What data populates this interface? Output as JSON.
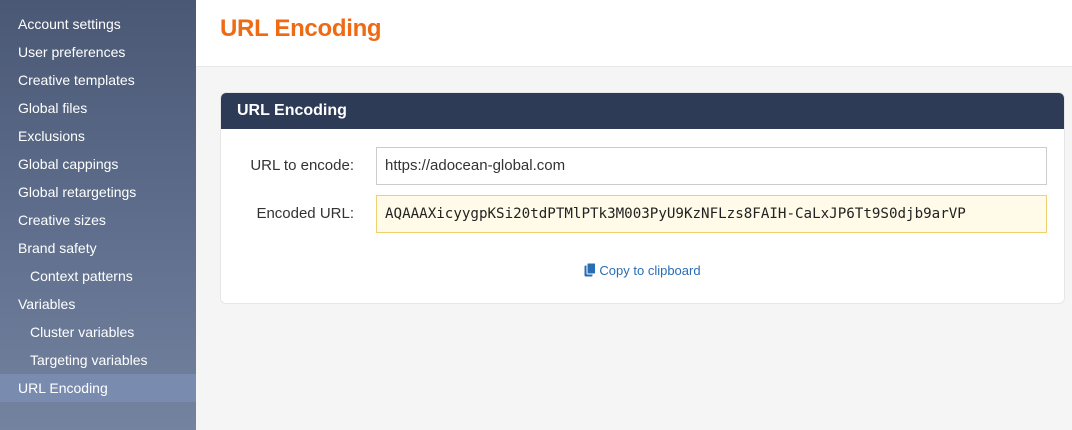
{
  "sidebar": {
    "items": [
      {
        "label": "Account settings"
      },
      {
        "label": "User preferences"
      },
      {
        "label": "Creative templates"
      },
      {
        "label": "Global files"
      },
      {
        "label": "Exclusions"
      },
      {
        "label": "Global cappings"
      },
      {
        "label": "Global retargetings"
      },
      {
        "label": "Creative sizes"
      },
      {
        "label": "Brand safety"
      },
      {
        "label": "Context patterns"
      },
      {
        "label": "Variables"
      },
      {
        "label": "Cluster variables"
      },
      {
        "label": "Targeting variables"
      },
      {
        "label": "URL Encoding"
      }
    ]
  },
  "header": {
    "title": "URL Encoding"
  },
  "panel": {
    "title": "URL Encoding",
    "url_label": "URL to encode:",
    "url_value": "https://adocean-global.com",
    "encoded_label": "Encoded URL:",
    "encoded_value": "AQAAAXicyygpKSi20tdPTMlPTk3M003PyU9KzNFLzs8FAIH-CaLxJP6Tt9S0djb9arVP",
    "copy_label": "Copy to clipboard"
  },
  "colors": {
    "accent_title": "#ee6a14",
    "panel_header": "#2d3b57",
    "link": "#2a6db5",
    "active_nav": "#7a8bb0"
  }
}
